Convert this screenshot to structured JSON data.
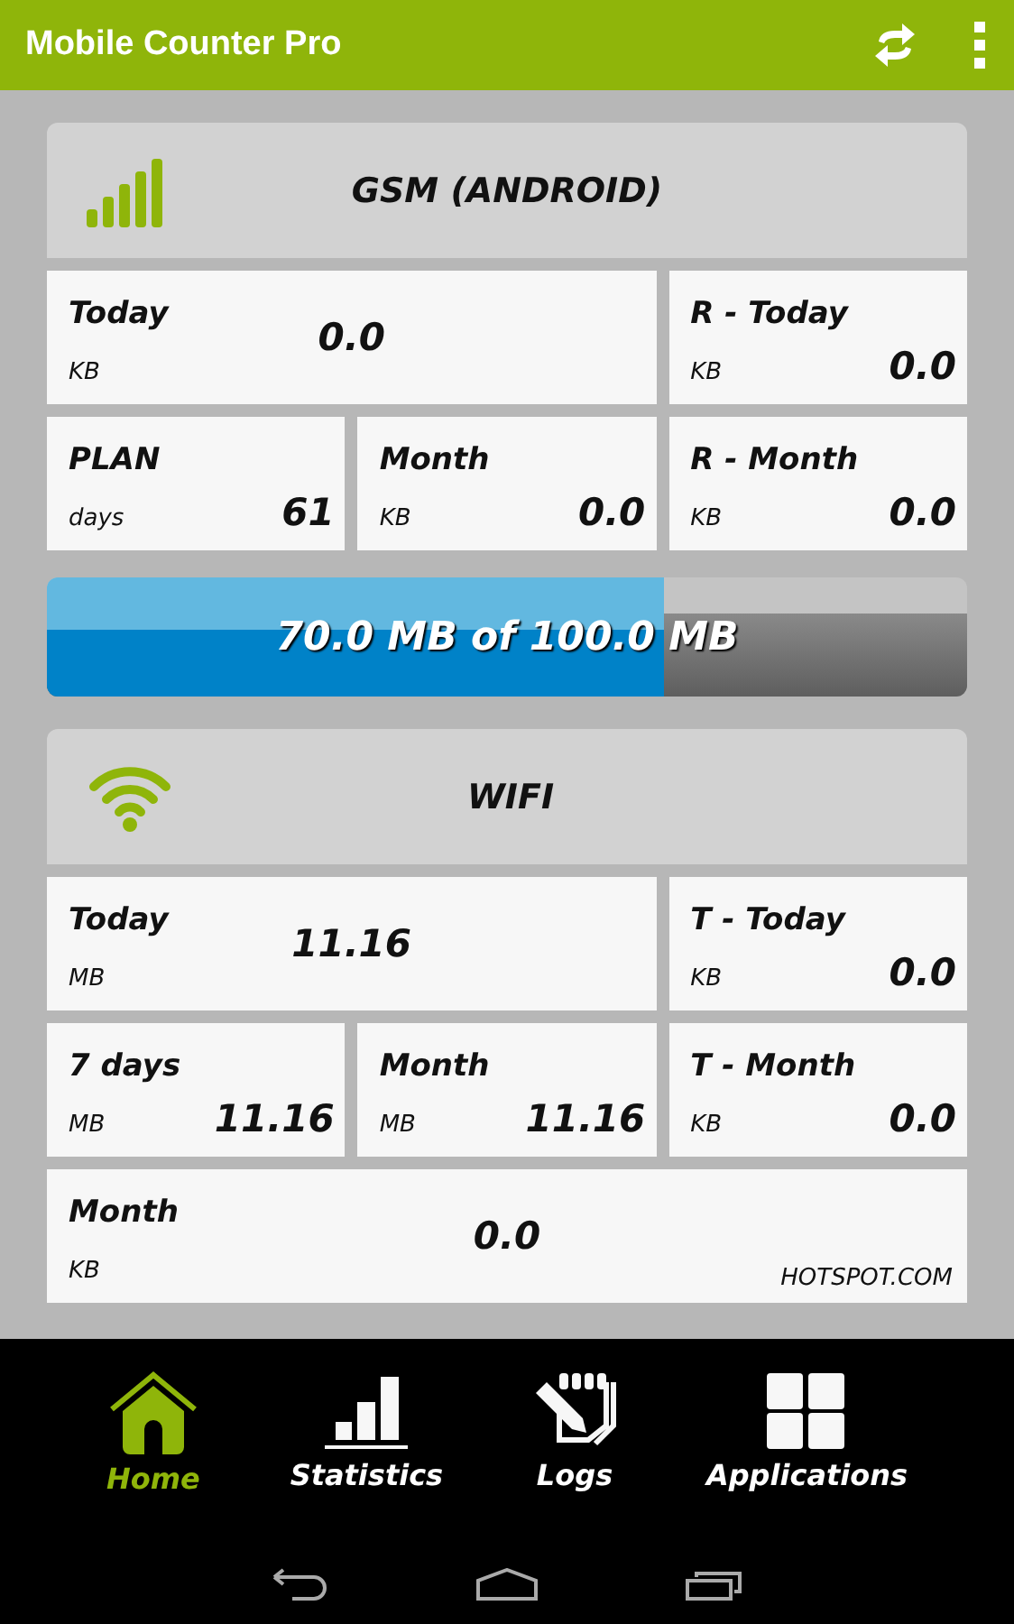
{
  "app_bar": {
    "title": "Mobile Counter Pro"
  },
  "sections": [
    {
      "title": "GSM (ANDROID)",
      "tiles": [
        {
          "kind": "wide",
          "label": "Today",
          "unit": "KB",
          "value": "0.0"
        },
        {
          "kind": "small",
          "label": "R - Today",
          "unit": "KB",
          "value": "0.0"
        },
        {
          "kind": "small",
          "label": "PLAN",
          "unit": "days",
          "value": "61"
        },
        {
          "kind": "small",
          "label": "Month",
          "unit": "KB",
          "value": "0.0"
        },
        {
          "kind": "small",
          "label": "R - Month",
          "unit": "KB",
          "value": "0.0"
        }
      ],
      "progress": {
        "text": "70.0 MB of 100.0 MB",
        "level": 0.67
      }
    },
    {
      "title": "WIFI",
      "tiles": [
        {
          "kind": "wide",
          "label": "Today",
          "unit": "MB",
          "value": "11.16"
        },
        {
          "kind": "small",
          "label": "T - Today",
          "unit": "KB",
          "value": "0.0"
        },
        {
          "kind": "small",
          "label": "7 days",
          "unit": "MB",
          "value": "11.16"
        },
        {
          "kind": "small",
          "label": "Month",
          "unit": "MB",
          "value": "11.16"
        },
        {
          "kind": "small",
          "label": "T - Month",
          "unit": "KB",
          "value": "0.0"
        },
        {
          "kind": "full",
          "label": "Month",
          "unit": "KB",
          "value": "0.0",
          "note": "HOTSPOT.COM"
        }
      ]
    }
  ],
  "bottom_nav": [
    {
      "label": "Home",
      "selected": true
    },
    {
      "label": "Statistics",
      "selected": false
    },
    {
      "label": "Logs",
      "selected": false
    },
    {
      "label": "Applications",
      "selected": false
    }
  ]
}
